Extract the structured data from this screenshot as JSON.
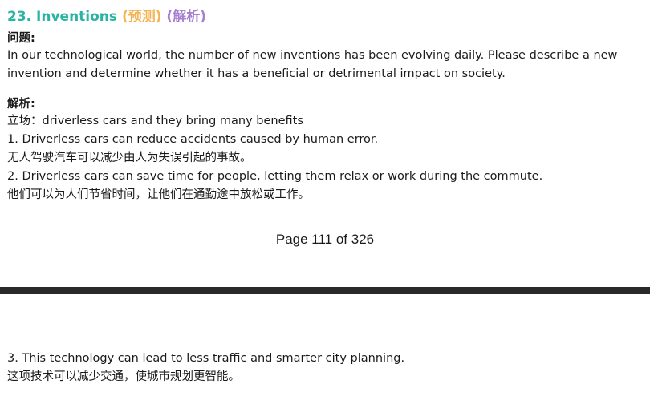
{
  "title": {
    "main": "23. Inventions",
    "tag_predict": "(预测)",
    "tag_analysis": "(解析)"
  },
  "question": {
    "label": "问题:",
    "line1": "In our technological world, the number of new inventions has been evolving daily. Please describe a new",
    "line2": "invention and determine whether it has a beneficial or detrimental impact on society."
  },
  "analysis": {
    "label": "解析:",
    "stance": "立场：driverless cars and they bring many benefits",
    "points": [
      {
        "en": "1. Driverless cars can reduce accidents caused by human error.",
        "zh": "无人驾驶汽车可以减少由人为失误引起的事故。"
      },
      {
        "en": "2. Driverless cars can save time for people, letting them relax or work during the commute.",
        "zh": "他们可以为人们节省时间，让他们在通勤途中放松或工作。"
      },
      {
        "en": "3. This technology can lead to less traffic and smarter city planning.",
        "zh": "这项技术可以减少交通，使城市规划更智能。"
      }
    ]
  },
  "footer": {
    "page_label": "Page 111 of 326"
  },
  "colors": {
    "title": "#2bb3a3",
    "tag_predict": "#f2b451",
    "tag_analysis": "#a67fd1",
    "divider": "#2a2a2a"
  }
}
